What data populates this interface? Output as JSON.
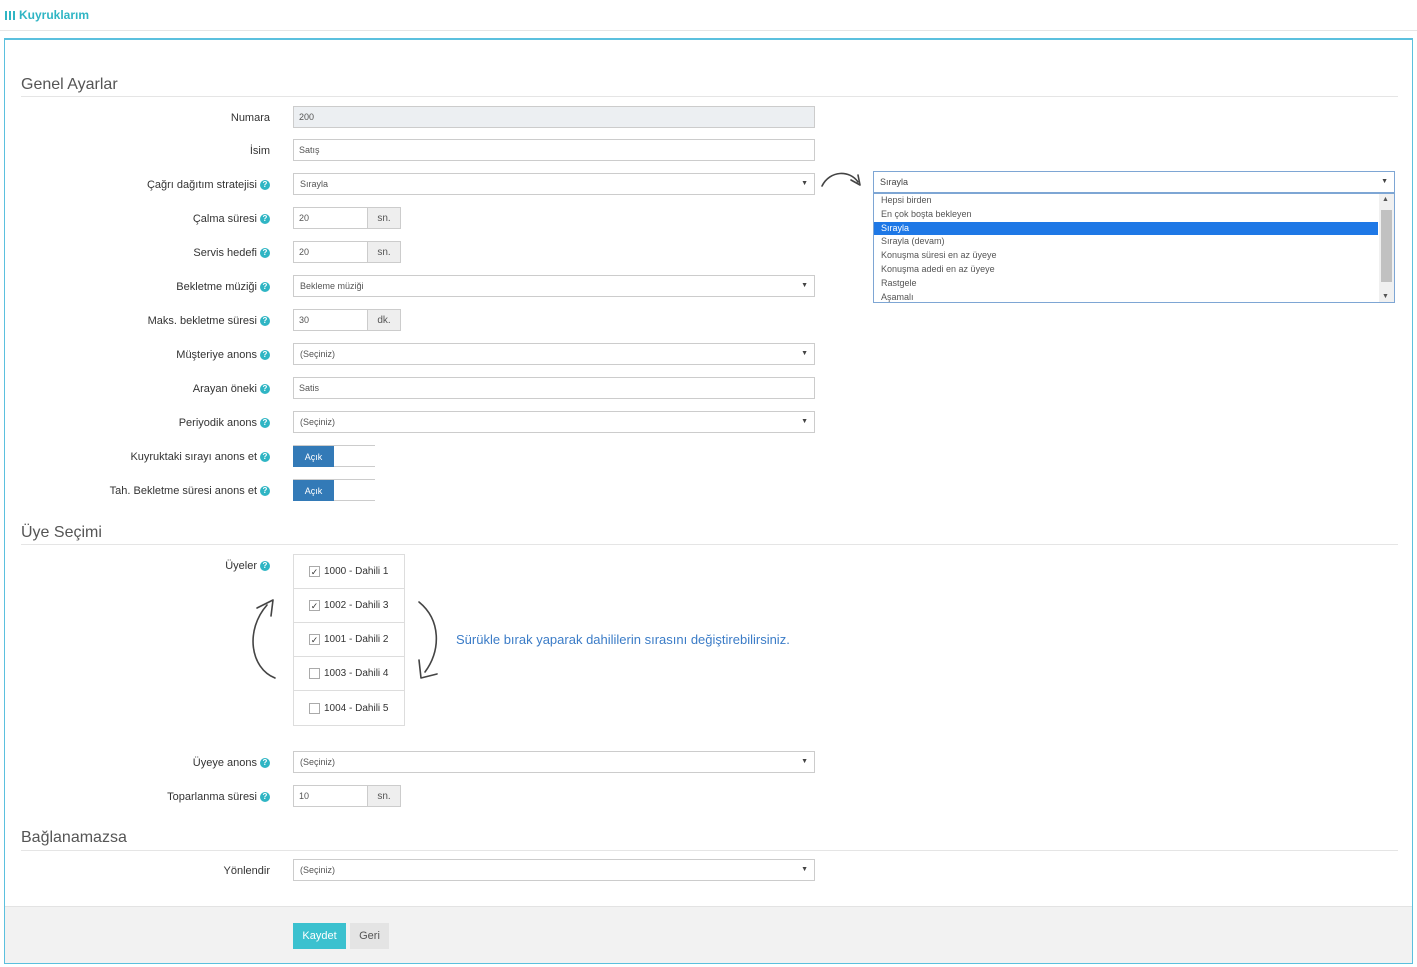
{
  "header": {
    "title": "Kuyruklarım"
  },
  "sections": {
    "general": "Genel Ayarlar",
    "members": "Üye Seçimi",
    "fallback": "Bağlanamazsa"
  },
  "fields": {
    "number": {
      "label": "Numara",
      "value": "200"
    },
    "name": {
      "label": "İsim",
      "value": "Satış"
    },
    "strategy": {
      "label": "Çağrı dağıtım stratejisi",
      "value": "Sırayla"
    },
    "ring_time": {
      "label": "Çalma süresi",
      "value": "20",
      "unit": "sn."
    },
    "service_target": {
      "label": "Servis hedefi",
      "value": "20",
      "unit": "sn."
    },
    "hold_music": {
      "label": "Bekletme müziği",
      "value": "Bekleme müziği"
    },
    "max_wait": {
      "label": "Maks. bekletme süresi",
      "value": "30",
      "unit": "dk."
    },
    "customer_announce": {
      "label": "Müşteriye anons",
      "value": "(Seçiniz)"
    },
    "caller_prefix": {
      "label": "Arayan öneki",
      "value": "Satis"
    },
    "periodic_announce": {
      "label": "Periyodik anons",
      "value": "(Seçiniz)"
    },
    "announce_position": {
      "label": "Kuyruktaki sırayı anons et",
      "value": "Açık"
    },
    "announce_wait": {
      "label": "Tah. Bekletme süresi anons et",
      "value": "Açık"
    },
    "members_label": "Üyeler",
    "member_announce": {
      "label": "Üyeye anons",
      "value": "(Seçiniz)"
    },
    "wrapup_time": {
      "label": "Toparlanma süresi",
      "value": "10",
      "unit": "sn."
    },
    "redirect": {
      "label": "Yönlendir",
      "value": "(Seçiniz)"
    }
  },
  "members": [
    {
      "label": "1000 - Dahili 1",
      "checked": true
    },
    {
      "label": "1002 - Dahili 3",
      "checked": true
    },
    {
      "label": "1001 - Dahili 2",
      "checked": true
    },
    {
      "label": "1003 - Dahili 4",
      "checked": false
    },
    {
      "label": "1004 - Dahili 5",
      "checked": false
    }
  ],
  "hint": "Sürükle bırak yaparak dahililerin sırasını değiştirebilirsiniz.",
  "strategy_dropdown": {
    "value": "Sırayla",
    "options": [
      "Hepsi birden",
      "En çok boşta bekleyen",
      "Sırayla",
      "Sırayla (devam)",
      "Konuşma süresi en az üyeye",
      "Konuşma adedi en az üyeye",
      "Rastgele",
      "Aşamalı"
    ],
    "selected_index": 2
  },
  "buttons": {
    "save": "Kaydet",
    "back": "Geri"
  },
  "check_glyph": "✓",
  "colors": {
    "accent": "#2fb5c4",
    "toggle_on": "#337ab7",
    "hint": "#3b7cc7"
  }
}
